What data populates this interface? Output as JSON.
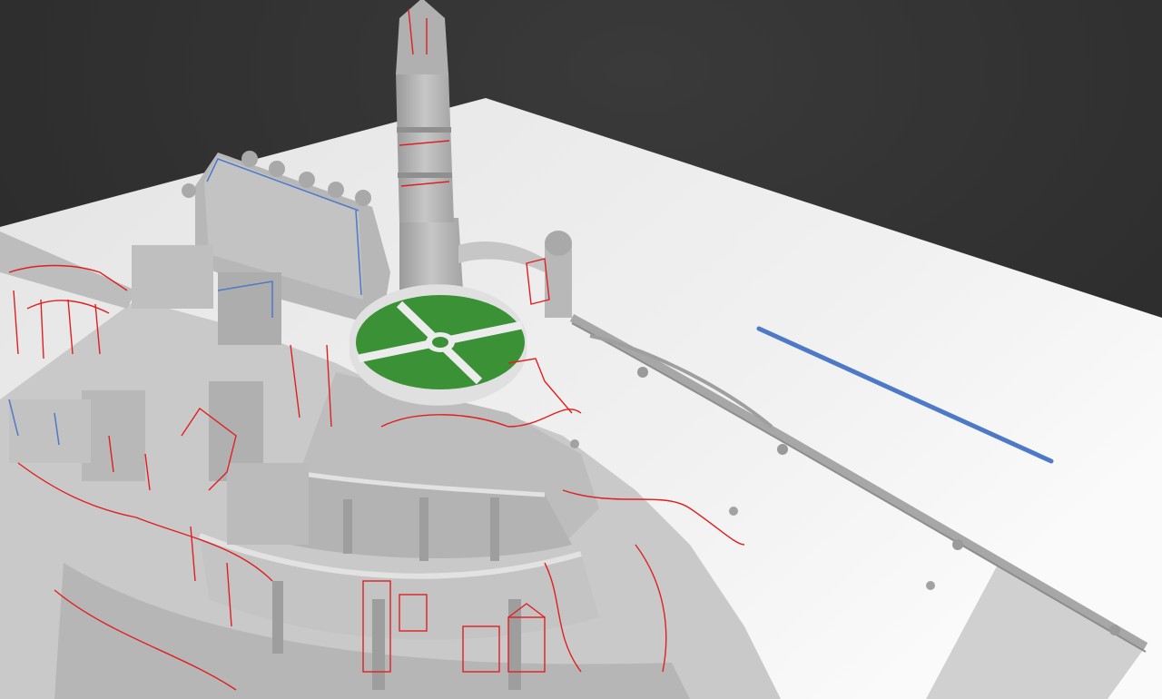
{
  "viewport": {
    "background_colors": [
      "#262626",
      "#3d3d3d"
    ],
    "terrain_color": "#ececec",
    "model_color": "#bdbdbd",
    "sketch_color": "#e02020",
    "annotation_color": "#4d79c7",
    "courtyard_color": "#3b9236"
  },
  "objects": [
    {
      "name": "white-tower",
      "kind": "model"
    },
    {
      "name": "citadel-hall",
      "kind": "model"
    },
    {
      "name": "tiered-city-walls",
      "kind": "model"
    },
    {
      "name": "courtyard-circle",
      "kind": "model"
    },
    {
      "name": "watch-turret",
      "kind": "model"
    },
    {
      "name": "ridge-wall",
      "kind": "model"
    },
    {
      "name": "red-sketch-overlay",
      "kind": "annotation"
    },
    {
      "name": "blue-stroke",
      "kind": "annotation"
    }
  ]
}
